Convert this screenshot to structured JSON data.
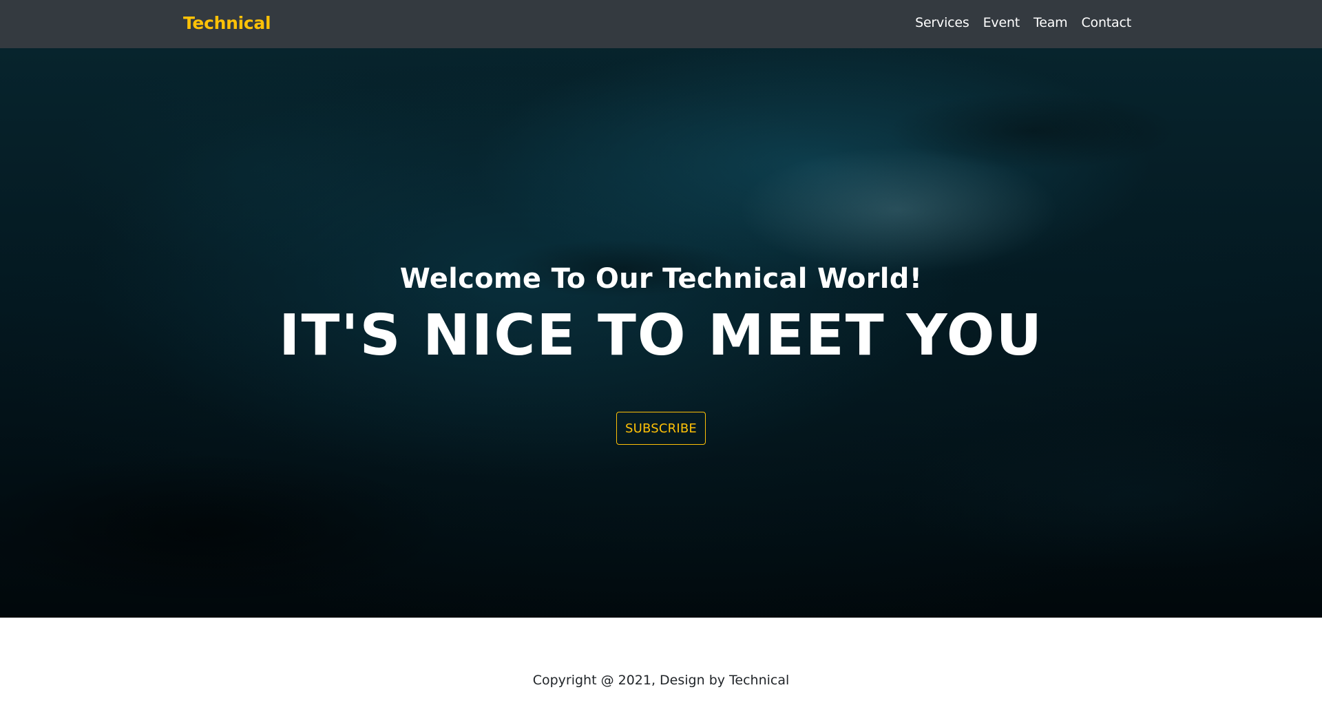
{
  "navbar": {
    "brand": "Technical",
    "links": [
      "Services",
      "Event",
      "Team",
      "Contact"
    ]
  },
  "hero": {
    "welcome": "Welcome To Our Technical World!",
    "headline": "IT'S NICE TO MEET YOU",
    "subscribe_label": "SUBSCRIBE"
  },
  "footer": {
    "copyright": "Copyright @ 2021, Design by Technical"
  },
  "colors": {
    "navbar_bg": "#343a40",
    "brand": "#ffc107",
    "accent": "#ffc107",
    "nav_text": "#ffffff",
    "hero_text": "#ffffff",
    "footer_text": "#212529"
  }
}
